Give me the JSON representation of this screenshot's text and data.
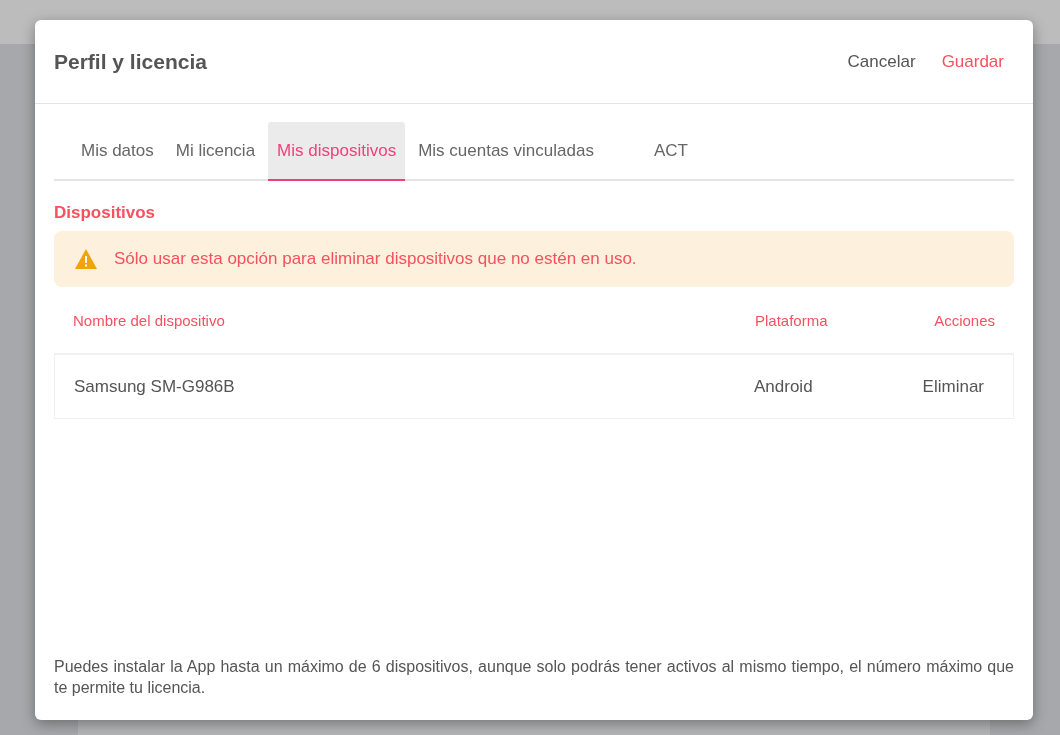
{
  "dialog": {
    "title": "Perfil y licencia",
    "actions": [
      {
        "label": "Cancelar",
        "kind": "secondary"
      },
      {
        "label": "Guardar",
        "kind": "primary"
      }
    ]
  },
  "tabs": [
    {
      "label": "Mis datos",
      "selected": false
    },
    {
      "label": "Mi licencia",
      "selected": false
    },
    {
      "label": "Mis dispositivos",
      "selected": true
    },
    {
      "label": "Mis cuentas vinculadas",
      "selected": false
    },
    {
      "label": "ACT",
      "selected": false
    }
  ],
  "section_title": "Dispositivos",
  "warning": "Sólo usar esta opción para eliminar dispositivos que no estén en uso.",
  "table": {
    "columns": [
      "Nombre del dispositivo",
      "Plataforma",
      "Acciones"
    ],
    "rows": [
      {
        "name": "Samsung SM-G986B",
        "platform": "Android",
        "action": "Eliminar"
      }
    ]
  },
  "footer_note": "Puedes instalar la App hasta un máximo de 6 dispositivos, aunque solo podrás tener activos al mismo tiempo, el número máximo que te permite tu licencia."
}
